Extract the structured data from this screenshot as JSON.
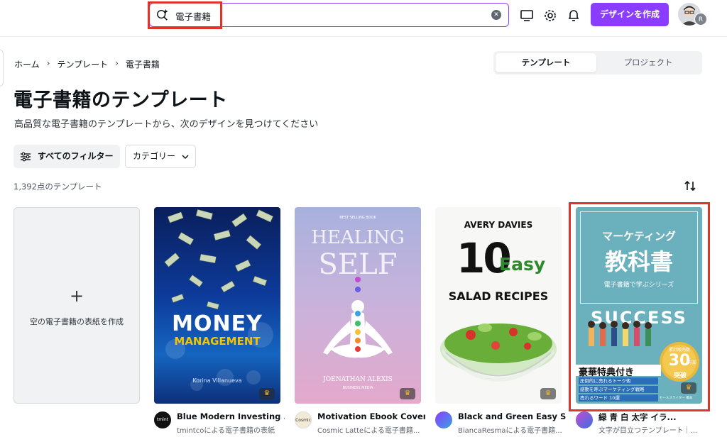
{
  "header": {
    "search_value": "電子書籍",
    "create_label": "デザインを作成",
    "avatar_initial": "R"
  },
  "breadcrumb": [
    "ホーム",
    "テンプレート",
    "電子書籍"
  ],
  "toggle": {
    "active": "テンプレート",
    "inactive": "プロジェクト"
  },
  "page": {
    "title": "電子書籍のテンプレート",
    "subtitle": "高品質な電子書籍のテンプレートから、次のデザインを見つけてください",
    "filter_label": "すべてのフィルター",
    "category_label": "カテゴリー",
    "count": "1,392点のテンプレート"
  },
  "blank_card": {
    "plus": "+",
    "label": "空の電子書籍の表紙を作成"
  },
  "templates": [
    {
      "cover_lines": [
        "MONEY",
        "MANAGEMENT",
        "Korina Villanueva"
      ],
      "title": "Blue Modern Investing ...",
      "sub": "tmintcoによる電子書籍の表紙",
      "logo_text": "tmint"
    },
    {
      "cover_lines": [
        "BEST SELLING BOOK",
        "HEALING",
        "SELF",
        "JOENATHAN ALEXIS",
        "BUSINESS MEDIA"
      ],
      "title": "Motivation Ebook Cover",
      "sub": "Cosmic Latteによる電子書籍...",
      "logo_text": "Cosmic"
    },
    {
      "cover_lines": [
        "AVERY DAVIES",
        "10",
        "Easy",
        "SALAD RECIPES"
      ],
      "title": "Black and Green Easy S...",
      "sub": "BiancaResmaによる電子書籍...",
      "logo_text": ""
    },
    {
      "cover_lines": [
        "マーケティング",
        "教科書",
        "電子書籍で学ぶシリーズ",
        "SUCCESS",
        "累計販売数",
        "30",
        "万部",
        "突破",
        "豪華特典付き",
        "圧倒的に売れるトーク術",
        "感動を呼ぶマーケティング戦略",
        "売れるワード 10選",
        "セールスライター 橋本"
      ],
      "title": "緑 青 白 太字 イラ...",
      "sub": "文字が目立つテンプレート｜...",
      "logo_text": ""
    }
  ],
  "colors": {
    "accent": "#8b3dff",
    "highlight": "#e0342a"
  }
}
